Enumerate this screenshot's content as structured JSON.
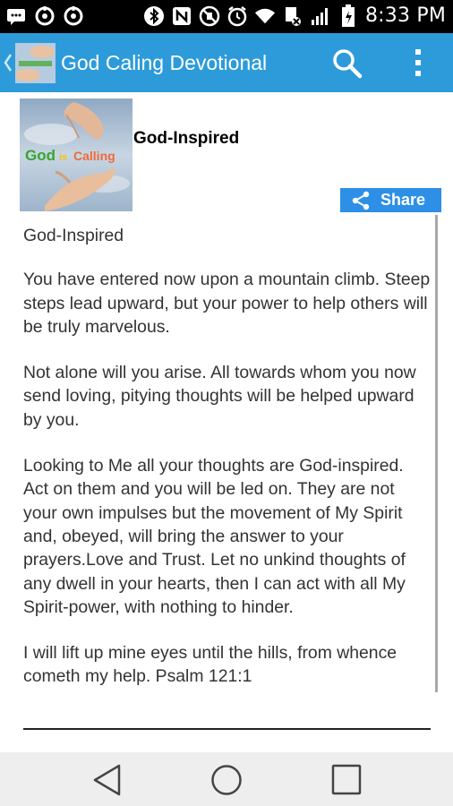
{
  "status_bar": {
    "time": "8:33 PM",
    "icons": [
      "chat-icon",
      "settings-icon",
      "settings-icon",
      "bluetooth-icon",
      "nfc-icon",
      "mute-icon",
      "alarm-icon",
      "wifi-icon",
      "mobile-data-icon",
      "signal-icon",
      "battery-icon"
    ]
  },
  "app_bar": {
    "title": "God Caling Devotional",
    "accent_color": "#2d9bd9"
  },
  "header": {
    "image_text_god": "God",
    "image_text_is": "is",
    "image_text_calling": "Calling",
    "title": "God-Inspired"
  },
  "share": {
    "label": "Share",
    "color": "#2d8fe6"
  },
  "content": {
    "title": "God-Inspired",
    "paragraphs": [
      "You have entered now upon a mountain climb.  Steep steps lead upward, but your power to help others will be truly marvelous.",
      "Not alone will you arise.  All towards whom you now send loving, pitying thoughts will be helped upward by you.",
      "Looking to Me all your thoughts are God-inspired.  Act on them and you will be led on. They are not your own impulses but the movement of My Spirit and, obeyed, will bring the answer to your prayers.Love and Trust.  Let no unkind thoughts of any dwell in your hearts, then I can act with all My Spirit-power, with nothing to hinder.",
      "I will lift up mine eyes until the hills, from whence cometh my help. Psalm 121:1"
    ]
  },
  "nav_bar": {
    "icons": [
      "back-icon",
      "home-icon",
      "recent-apps-icon"
    ]
  }
}
